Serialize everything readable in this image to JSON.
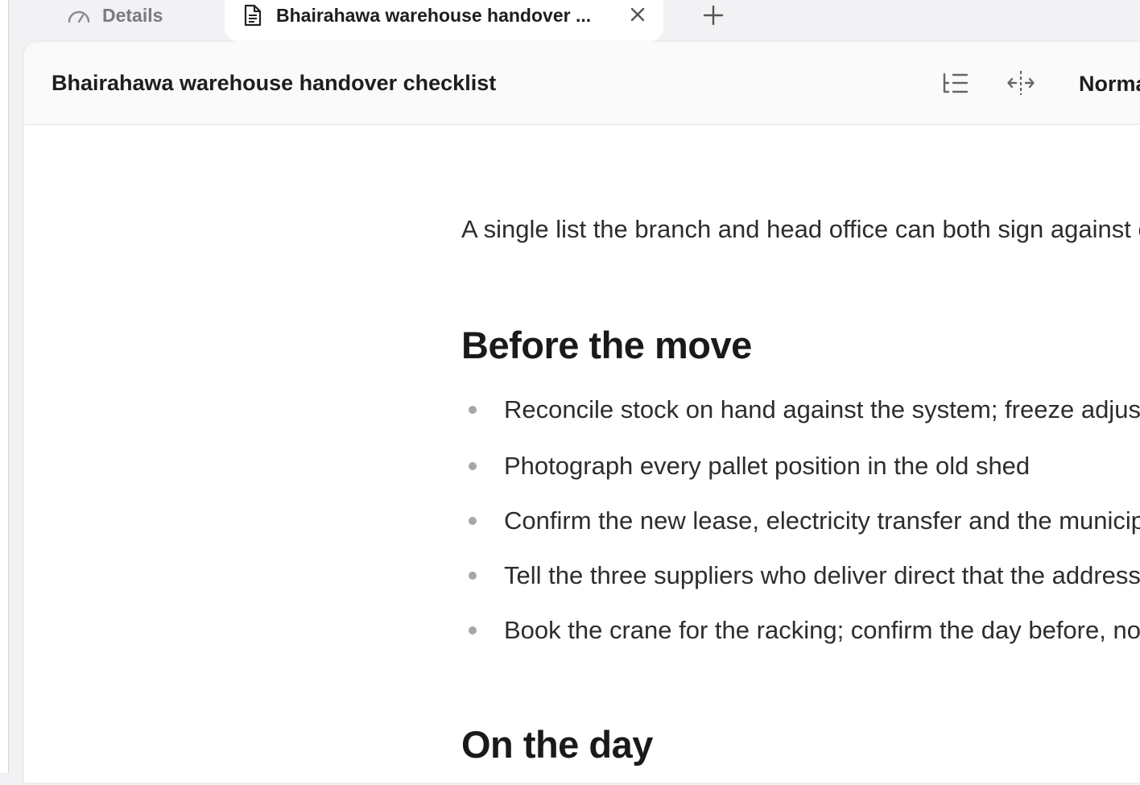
{
  "tabs": {
    "details_label": "Details",
    "active_label": "Bhairahawa warehouse handover ..."
  },
  "header": {
    "title": "Bhairahawa warehouse handover checklist",
    "mode_label": "Norma"
  },
  "document": {
    "intro": "A single list the branch and head office can both sign against o",
    "sections": [
      {
        "heading": "Before the move",
        "items": [
          "Reconcile stock on hand against the system; freeze adjust",
          "Photograph every pallet position in the old shed",
          "Confirm the new lease, electricity transfer and the municip",
          "Tell the three suppliers who deliver direct that the address",
          "Book the crane for the racking; confirm the day before, no"
        ]
      },
      {
        "heading": "On the day"
      }
    ]
  },
  "icons": {
    "details": "gauge-icon",
    "document": "document-icon",
    "close": "close-icon",
    "new_tab": "plus-icon",
    "outline": "outline-icon",
    "width": "expand-width-icon"
  }
}
